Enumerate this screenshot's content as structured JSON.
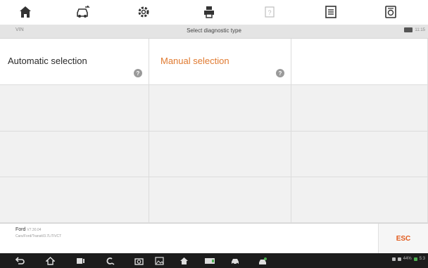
{
  "toolbar": {
    "icons": [
      "home-icon",
      "car-swap-icon",
      "settings-icon",
      "print-icon",
      "help-icon",
      "save-icon",
      "data-logging-icon"
    ]
  },
  "header": {
    "vin_label": "VIN",
    "title": "Select diagnostic type",
    "time": "11:15"
  },
  "options": [
    {
      "label": "Automatic selection",
      "color": "#2a2a2a"
    },
    {
      "label": "Manual selection",
      "color": "#e07a30"
    }
  ],
  "help_glyph": "?",
  "footer": {
    "make": "Ford",
    "version": "V7.30.04",
    "path": "Cars/Ford/Transit/3.7L/TiVCT",
    "esc_label": "ESC"
  },
  "navbar": {
    "icons": [
      "back-icon",
      "home-icon",
      "recent-apps-icon",
      "search-icon",
      "camera-icon",
      "gallery-icon",
      "home-app-icon",
      "vci-icon",
      "car-icon",
      "car-settings-icon"
    ],
    "battery": "44%",
    "time": "5:3"
  },
  "colors": {
    "accent": "#e07a30",
    "esc": "#e25a1c"
  }
}
